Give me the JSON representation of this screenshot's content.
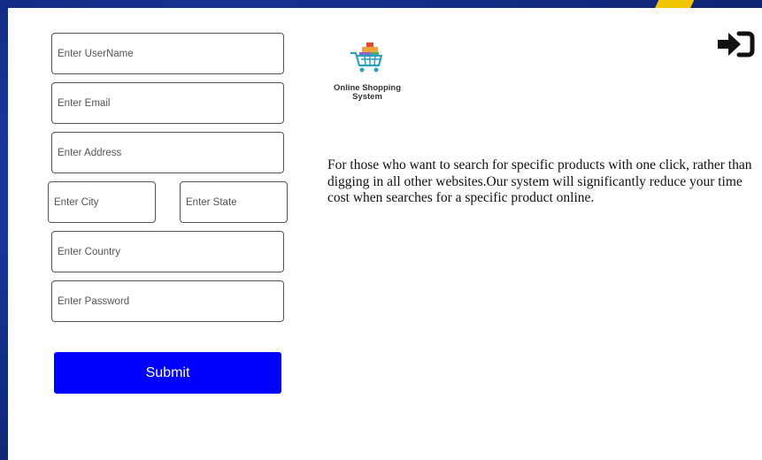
{
  "form": {
    "username_placeholder": "Enter UserName",
    "email_placeholder": "Enter Email",
    "address_placeholder": "Enter Address",
    "city_placeholder": "Enter City",
    "state_placeholder": "Enter State",
    "country_placeholder": "Enter Country",
    "password_placeholder": "Enter Password",
    "submit_label": "Submit"
  },
  "brand": {
    "name_line1": "Online Shopping",
    "name_line2": "System",
    "logo_icon": "shopping-cart-icon"
  },
  "description": "For those who want to search for specific products with one click, rather than digging in all other websites.Our system will significantly reduce your time cost when searches for a specific product online.",
  "header": {
    "logout_icon": "sign-in-arrow-icon"
  },
  "colors": {
    "background": "#15308e",
    "accent": "#f2c300",
    "submit_button": "#0000ff"
  }
}
